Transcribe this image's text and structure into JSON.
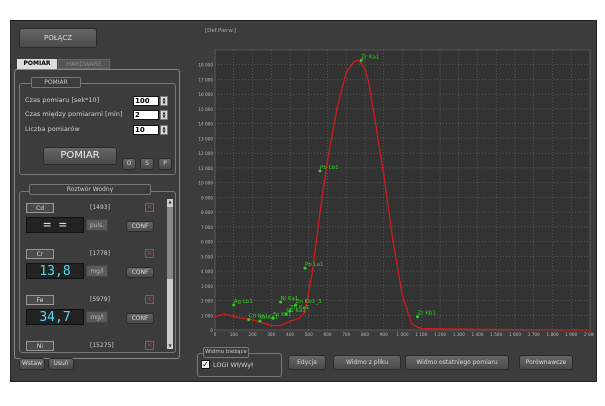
{
  "top": {
    "connect_label": "POŁĄCZ"
  },
  "tabs": [
    {
      "label": "POMIAR"
    },
    {
      "label": "HARDWARE"
    }
  ],
  "pomiar": {
    "group_title": "POMIAR",
    "fields": [
      {
        "label": "Czas pomiaru [sek*10]",
        "value": "100"
      },
      {
        "label": "Czas między pomiarami [min]",
        "value": "2"
      },
      {
        "label": "Liczba pomiarów",
        "value": "10"
      }
    ],
    "button_label": "POMIAR",
    "small_buttons": [
      "O",
      "S",
      "P"
    ]
  },
  "roztwor": {
    "title": "Roztwór Wodny",
    "conf_label": "CONF",
    "elements": [
      {
        "name": "Cd",
        "counts": "[1493]",
        "value": "= =",
        "unit": "puls."
      },
      {
        "name": "Cr",
        "counts": "[1778]",
        "value": "13,8",
        "unit": "mg/l"
      },
      {
        "name": "Fe",
        "counts": "[5979]",
        "value": "34,7",
        "unit": "mg/l"
      },
      {
        "name": "Ni",
        "counts": "[15275]"
      }
    ]
  },
  "bottom_left": {
    "insert_label": "Wstaw",
    "delete_label": "Usuń"
  },
  "spectrum_panel": {
    "group_title": "Widmo bieżące",
    "checkbox_label": "LOGI Wł/Wył"
  },
  "bottom_buttons": [
    "Edycja",
    "Widmo z pliku",
    "Widmo ostatniego pomiaru",
    "Porównawcze"
  ],
  "colors": {
    "background": "#3c3c3c",
    "spectrum_line": "#d11a1a",
    "peak_label": "#2fd21f",
    "value_text": "#57d7ea"
  },
  "chart_data": {
    "type": "line",
    "title": "[Def.Pierw.]",
    "xlim": [
      0,
      2000
    ],
    "ylim": [
      0,
      19000
    ],
    "xticks": [
      0,
      100,
      200,
      300,
      400,
      500,
      600,
      700,
      800,
      900,
      "1 000",
      "1 100",
      "1 200",
      "1 300",
      "1 400",
      "1 500",
      "1 600",
      "1 700",
      "1 800",
      "1 900",
      "2 000"
    ],
    "yticks": [
      0,
      "1 000",
      "2 000",
      "3 000",
      "4 000",
      "5 000",
      "6 000",
      "7 000",
      "8 000",
      "9 000",
      "10 000",
      "11 000",
      "12 000",
      "13 000",
      "14 000",
      "15 000",
      "16 000",
      "17 000",
      "18 000"
    ],
    "grid": true,
    "series": [
      {
        "x": [
          0,
          50,
          100,
          150,
          200,
          250,
          300,
          350,
          400,
          450,
          480,
          520,
          560,
          600,
          650,
          700,
          740,
          760,
          780,
          800,
          820,
          850,
          900,
          950,
          1000,
          1050,
          1080,
          1100,
          1200,
          1400,
          1700,
          2000
        ],
        "y": [
          900,
          1100,
          900,
          800,
          700,
          500,
          300,
          300,
          600,
          800,
          1200,
          4000,
          8000,
          11500,
          15000,
          17500,
          18200,
          18300,
          18100,
          17700,
          16800,
          14500,
          10500,
          6000,
          2300,
          400,
          200,
          100,
          80,
          50,
          30,
          0
        ]
      }
    ],
    "annotations": [
      {
        "text": "Zr Ka1",
        "x": 780,
        "y": 18300
      },
      {
        "text": "Pb Lb1",
        "x": 560,
        "y": 10800
      },
      {
        "text": "Pb La1",
        "x": 480,
        "y": 4200
      },
      {
        "text": "Ag Lb1",
        "x": 100,
        "y": 1700
      },
      {
        "text": "Ni Ka1",
        "x": 350,
        "y": 1900
      },
      {
        "text": "Zn Kb1_3",
        "x": 430,
        "y": 1700
      },
      {
        "text": "Zn Ka1",
        "x": 400,
        "y": 1300
      },
      {
        "text": "Cu Ka1",
        "x": 380,
        "y": 1100
      },
      {
        "text": "Fe Ka1",
        "x": 310,
        "y": 800
      },
      {
        "text": "Zr Kb1",
        "x": 1080,
        "y": 900
      },
      {
        "text": "Cd Ka1",
        "x": 180,
        "y": 700
      },
      {
        "text": "Cr Ka1",
        "x": 240,
        "y": 600
      }
    ]
  }
}
